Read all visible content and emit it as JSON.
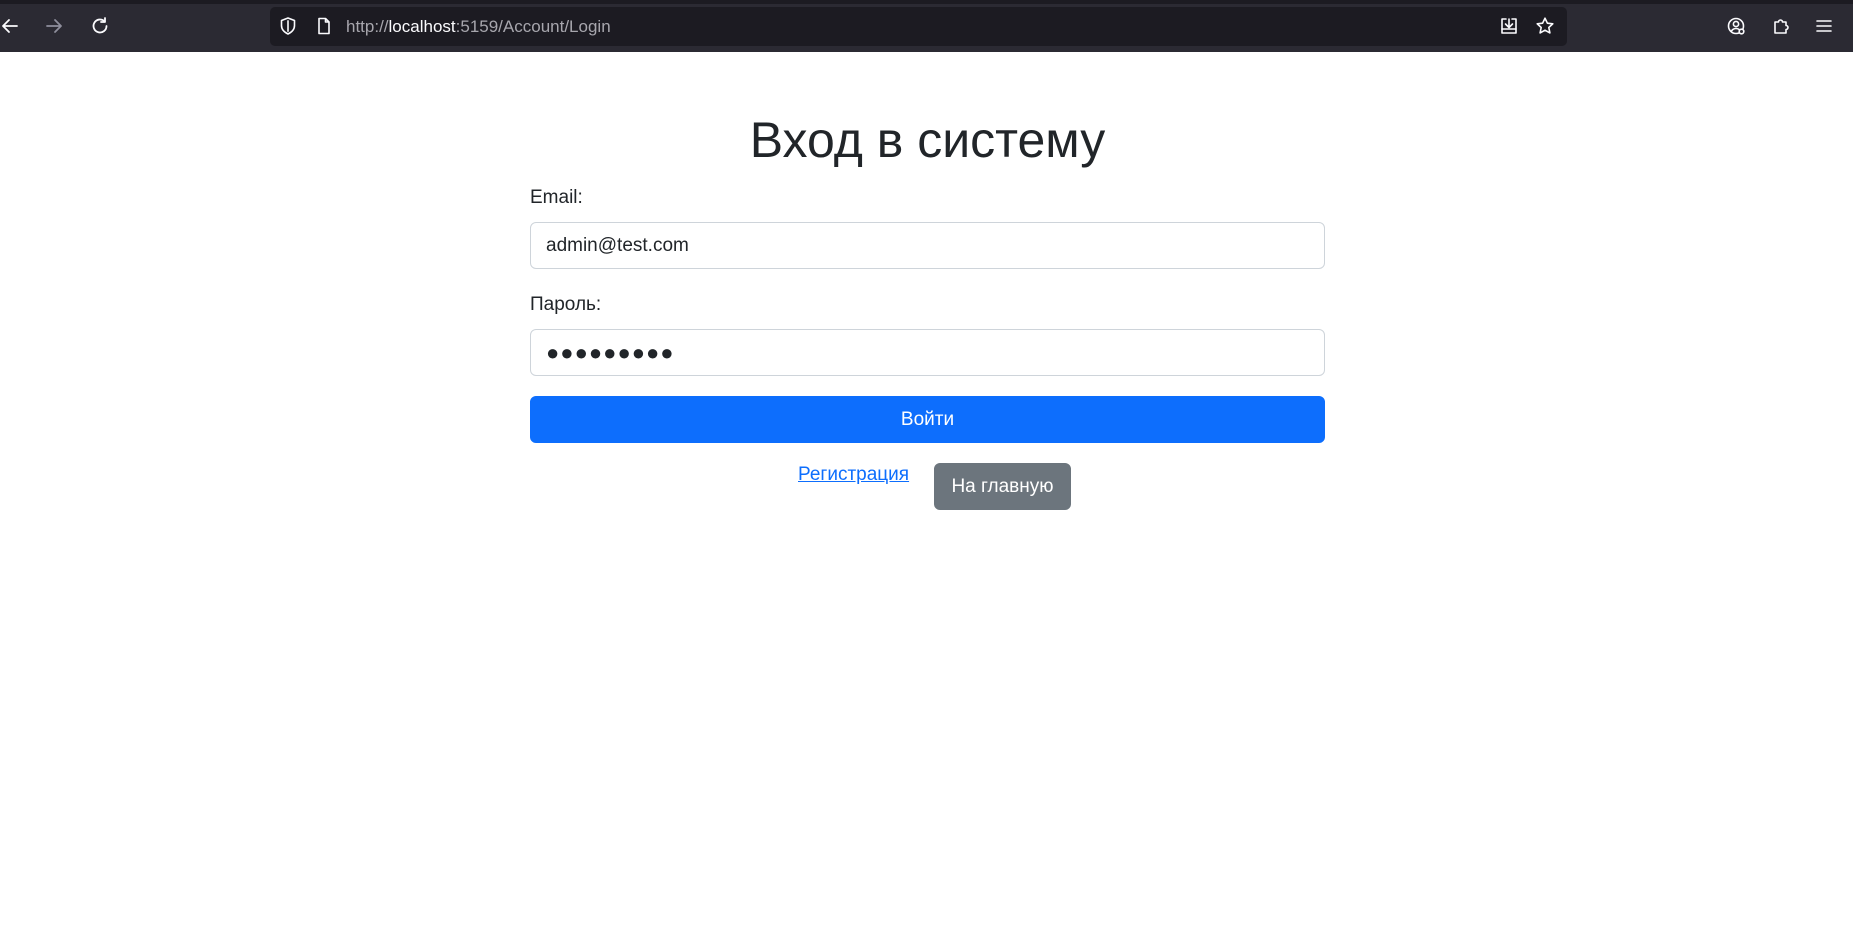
{
  "browser": {
    "url_prefix": "http://",
    "url_host": "localhost",
    "url_rest": ":5159/Account/Login",
    "icons": {
      "back": "back-arrow-icon",
      "forward": "forward-arrow-icon",
      "reload": "reload-icon",
      "shield": "tracking-protection-shield-icon",
      "page": "page-info-icon",
      "save": "save-to-pocket-icon",
      "bookmark": "bookmark-star-icon",
      "account": "account-icon",
      "extensions": "extensions-icon",
      "menu": "hamburger-menu-icon"
    }
  },
  "page": {
    "title": "Вход в систему",
    "email_label": "Email:",
    "email_value": "admin@test.com",
    "password_label": "Пароль:",
    "password_value": "●●●●●●●●●",
    "submit_label": "Войти",
    "register_link": "Регистрация",
    "home_button": "На главную"
  },
  "colors": {
    "primary": "#0d6efd",
    "secondary": "#6c757d",
    "toolbar": "#2b2a33",
    "urlbar": "#1c1b22"
  }
}
